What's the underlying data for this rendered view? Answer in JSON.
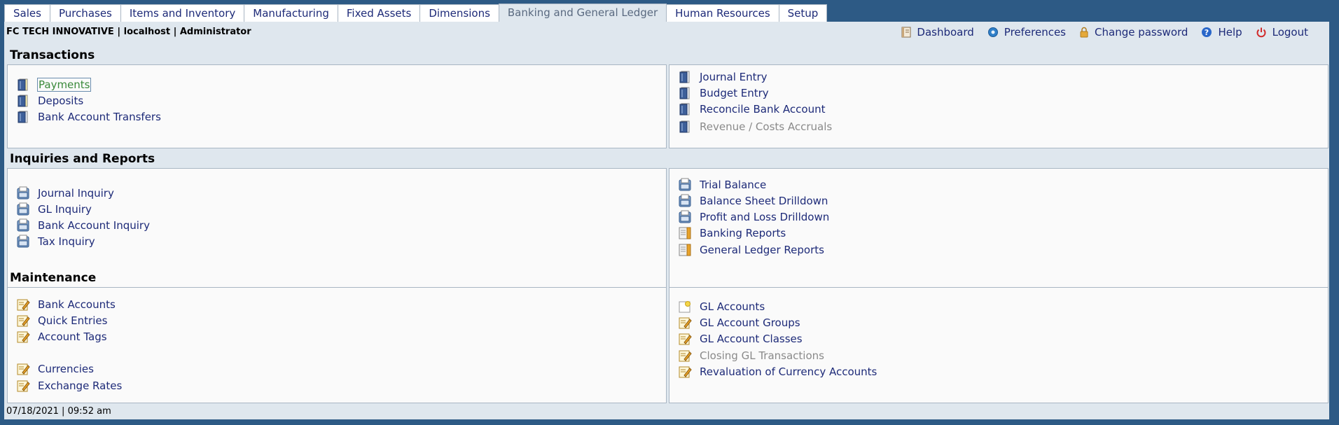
{
  "nav": {
    "tabs": [
      "Sales",
      "Purchases",
      "Items and Inventory",
      "Manufacturing",
      "Fixed Assets",
      "Dimensions",
      "Banking and General Ledger",
      "Human Resources",
      "Setup"
    ],
    "active_tab": "Banking and General Ledger"
  },
  "header": {
    "company_info": "FC TECH INNOVATIVE | localhost | Administrator",
    "links": {
      "dashboard": "Dashboard",
      "preferences": "Preferences",
      "change_password": "Change password",
      "help": "Help",
      "logout": "Logout"
    }
  },
  "transactions": {
    "title": "Transactions",
    "left": [
      "Payments",
      "Deposits",
      "Bank Account Transfers"
    ],
    "right": [
      "Journal Entry",
      "Budget Entry",
      "Reconcile Bank Account",
      "Revenue / Costs Accruals"
    ]
  },
  "inquiries": {
    "title": "Inquiries and Reports",
    "left": [
      "Journal Inquiry",
      "GL Inquiry",
      "Bank Account Inquiry",
      "Tax Inquiry"
    ],
    "right": [
      "Trial Balance",
      "Balance Sheet Drilldown",
      "Profit and Loss Drilldown",
      "Banking Reports",
      "General Ledger Reports"
    ]
  },
  "maintenance": {
    "title": "Maintenance",
    "left": [
      "Bank Accounts",
      "Quick Entries",
      "Account Tags",
      "Currencies",
      "Exchange Rates"
    ],
    "right": [
      "GL Accounts",
      "GL Account Groups",
      "GL Account Classes",
      "Closing GL Transactions",
      "Revaluation of Currency Accounts"
    ]
  },
  "footer": {
    "datetime": "07/18/2021 | 09:52 am"
  },
  "icons": {
    "transaction": "book-icon",
    "inquiry": "folder-report-icon",
    "report": "report-list-icon",
    "maintenance": "edit-note-icon",
    "new_account": "new-document-icon"
  }
}
